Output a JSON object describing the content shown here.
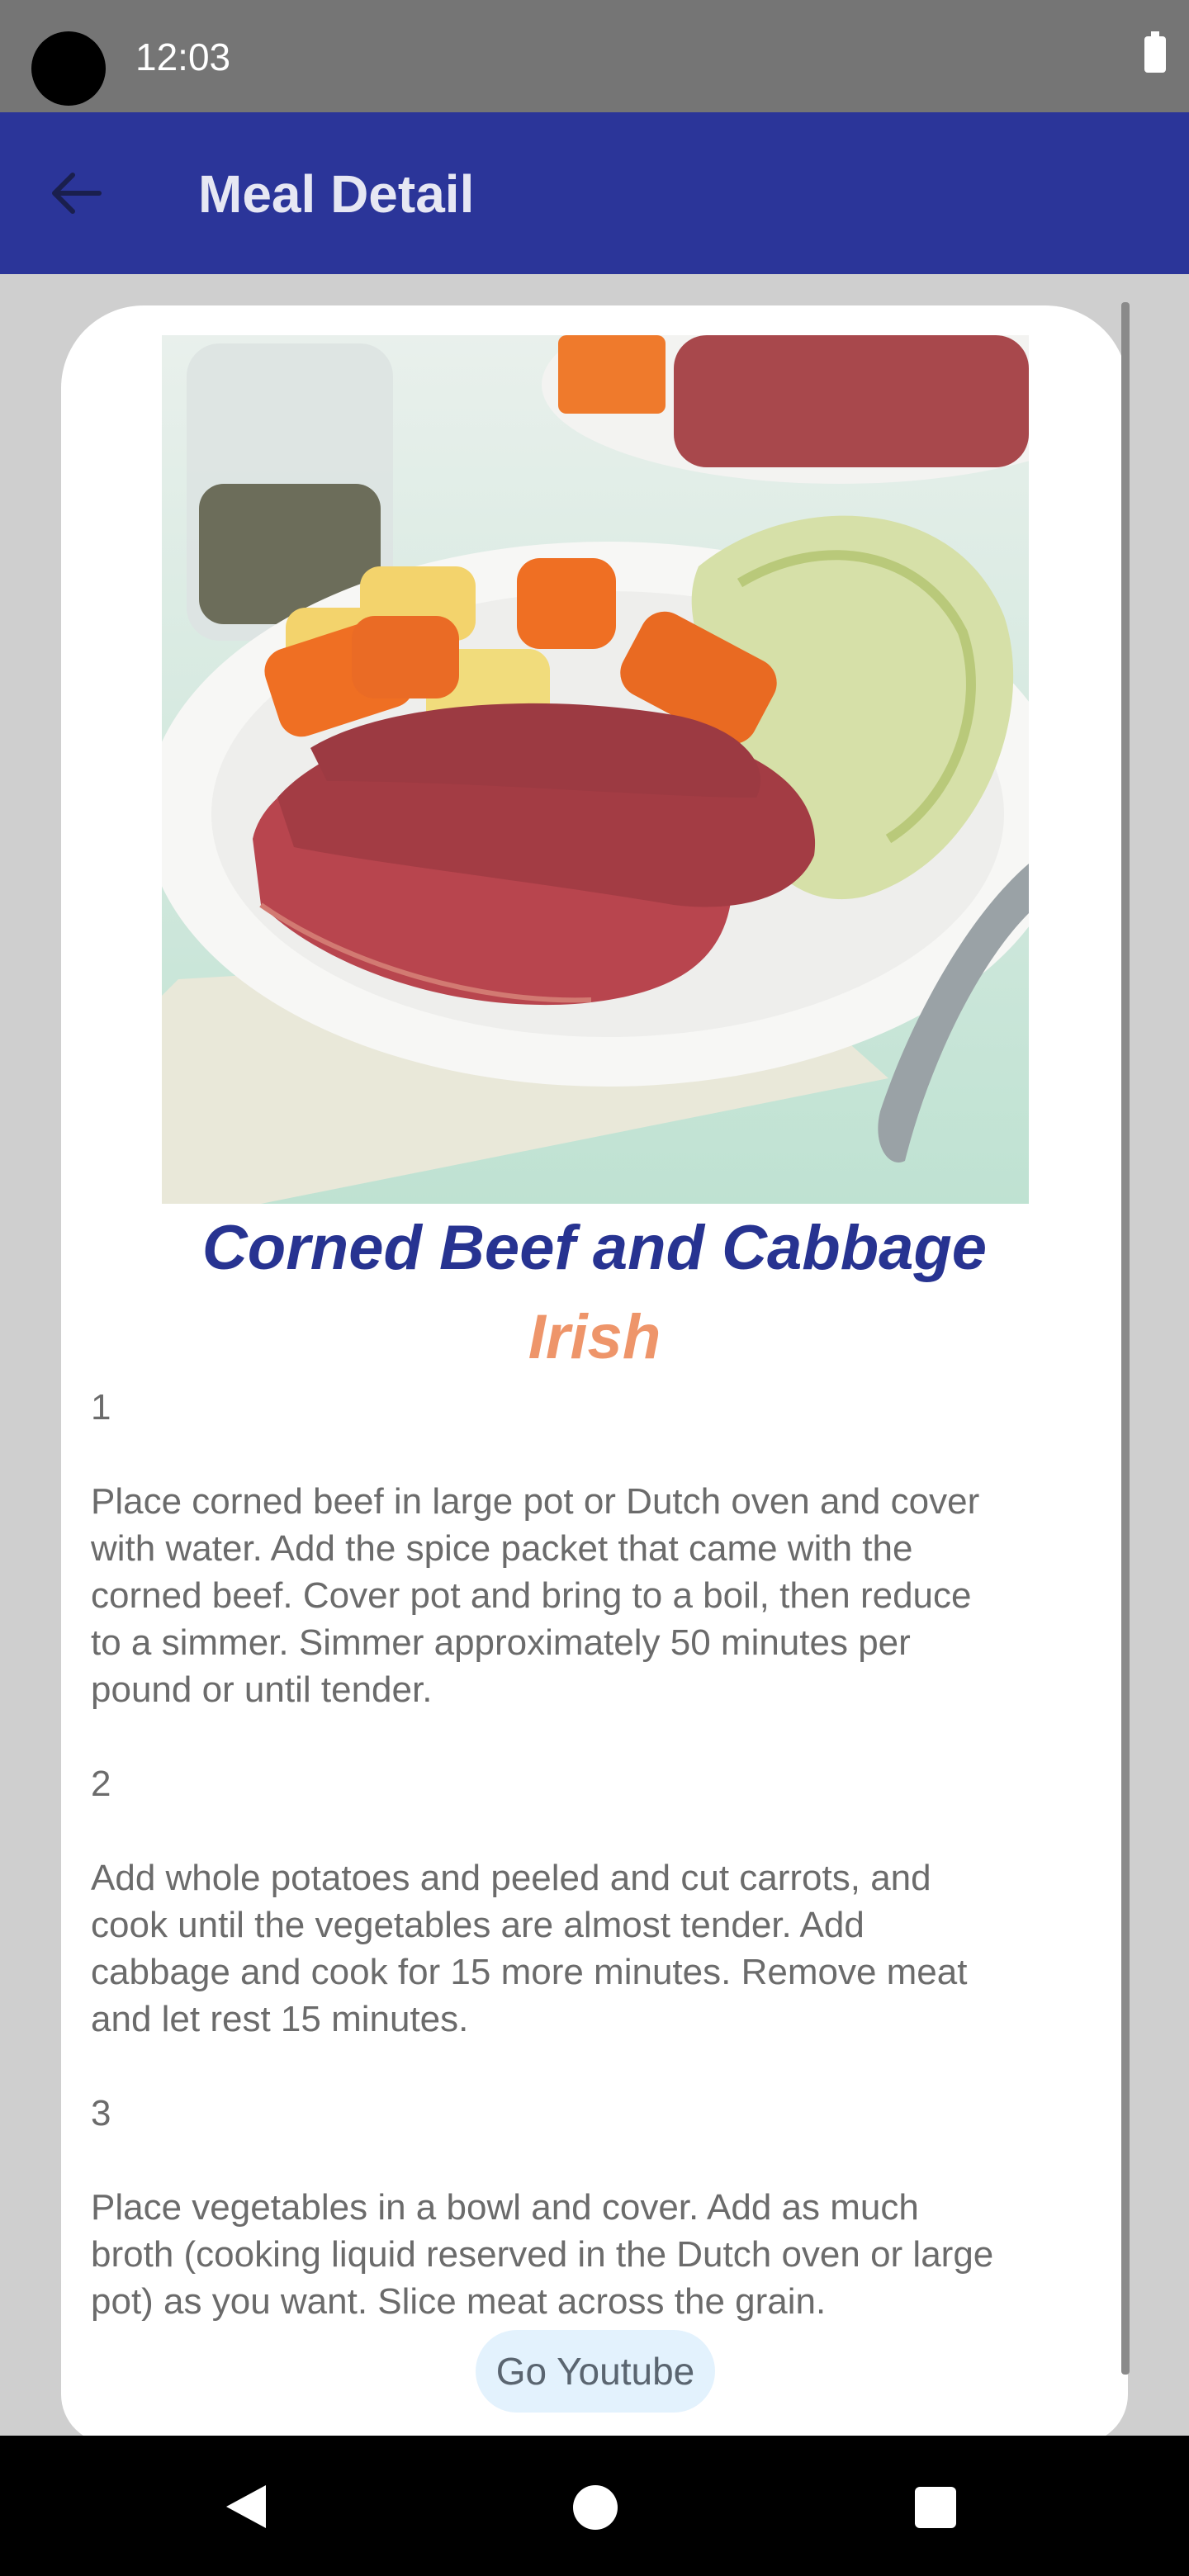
{
  "status_bar": {
    "time": "12:03"
  },
  "app_bar": {
    "title": "Meal Detail",
    "back_icon": "arrow-left-icon"
  },
  "meal": {
    "name": "Corned Beef and Cabbage",
    "area": "Irish",
    "image_description": "corned-beef-cabbage-plate-image",
    "instructions": [
      {
        "step": "1",
        "lines": [
          "Place corned beef in large pot or Dutch oven and cover",
          "with water. Add the spice packet that came with the",
          "corned beef. Cover pot and bring to a boil, then reduce",
          "to a simmer. Simmer approximately 50 minutes per",
          "pound or until tender."
        ]
      },
      {
        "step": "2",
        "lines": [
          "Add whole potatoes and peeled and cut carrots, and",
          "cook until the vegetables are almost tender. Add",
          "cabbage and cook for 15 more minutes. Remove meat",
          "and let rest 15 minutes."
        ]
      },
      {
        "step": "3",
        "lines": [
          "Place vegetables in a bowl and cover. Add as much",
          "broth (cooking liquid reserved in the Dutch oven or large",
          "pot) as you want. Slice meat across the grain."
        ]
      }
    ]
  },
  "buttons": {
    "youtube_label": "Go Youtube"
  },
  "colors": {
    "app_bar": "#2b3599",
    "title": "#273391",
    "area": "#ee956a",
    "button_bg": "#e3f2fd"
  }
}
